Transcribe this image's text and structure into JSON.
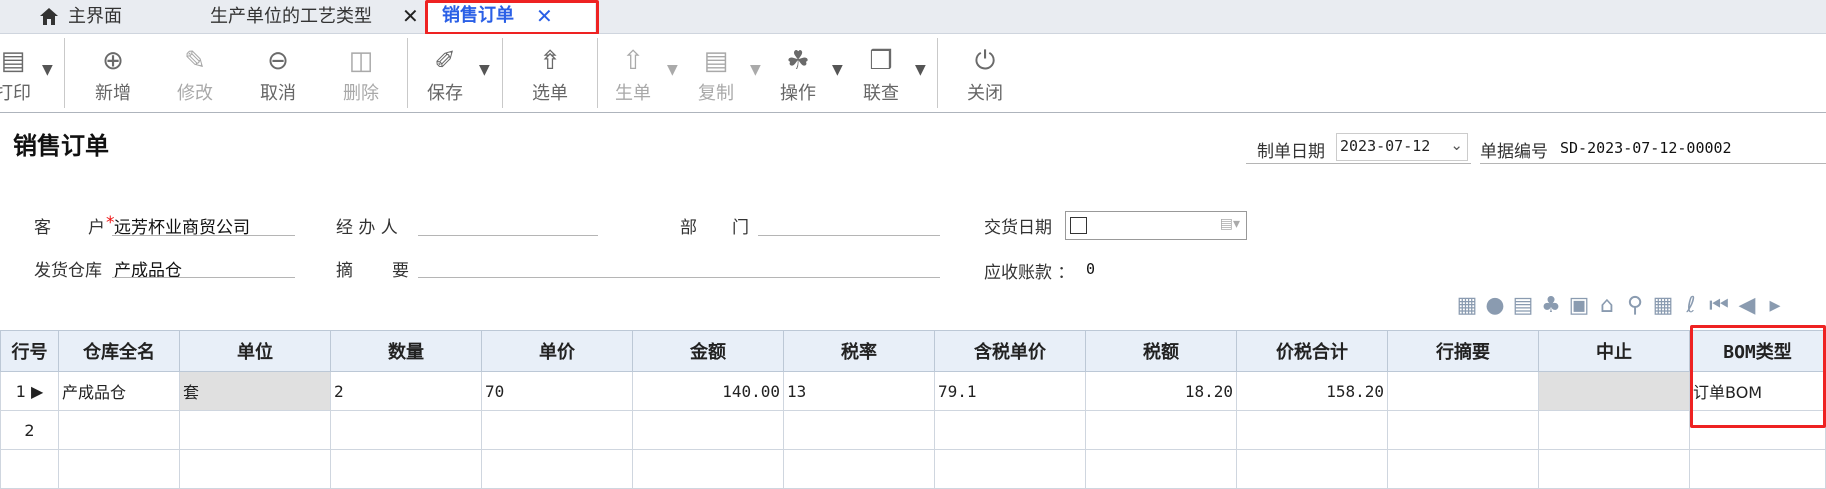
{
  "tabs": {
    "home": "主界面",
    "process": "生产单位的工艺类型",
    "active": "销售订单",
    "close_glyph": "✕"
  },
  "toolbar": {
    "print": "打印",
    "add": "新增",
    "edit": "修改",
    "cancel": "取消",
    "delete": "删除",
    "save": "保存",
    "select": "选单",
    "generate": "生单",
    "copy": "复制",
    "operate": "操作",
    "linked": "联查",
    "close": "关闭"
  },
  "form": {
    "title": "销售订单",
    "make_date_label": "制单日期",
    "make_date": "2023-07-12",
    "doc_no_label": "单据编号",
    "doc_no": "SD-2023-07-12-00002",
    "customer_label_1": "客",
    "customer_label_2": "户",
    "customer_required": "*",
    "customer": "远芳杯业商贸公司",
    "handler_label": "经 办 人",
    "dept_label_1": "部",
    "dept_label_2": "门",
    "delivery_label": "交货日期",
    "warehouse_label": "发货仓库",
    "warehouse": "产成品仓",
    "summary_label_1": "摘",
    "summary_label_2": "要",
    "receivable_label": "应收账款 ：",
    "receivable": "0"
  },
  "grid": {
    "headers": [
      "行号",
      "仓库全名",
      "单位",
      "数量",
      "单价",
      "金额",
      "税率",
      "含税单价",
      "税额",
      "价税合计",
      "行摘要",
      "中止",
      "BOM类型"
    ],
    "row1": {
      "no": "1",
      "warehouse": "产成品仓",
      "unit": "套",
      "qty": "2",
      "price": "70",
      "amount": "140.00",
      "tax_rate": "13",
      "price_with_tax": "79.1",
      "tax": "18.20",
      "total": "158.20",
      "bom_type": "订单BOM"
    },
    "row2": {
      "no": "2"
    }
  },
  "colors": {
    "accent": "#2a5fe6",
    "highlight": "#e22222",
    "header_bg": "#e8eff8"
  }
}
